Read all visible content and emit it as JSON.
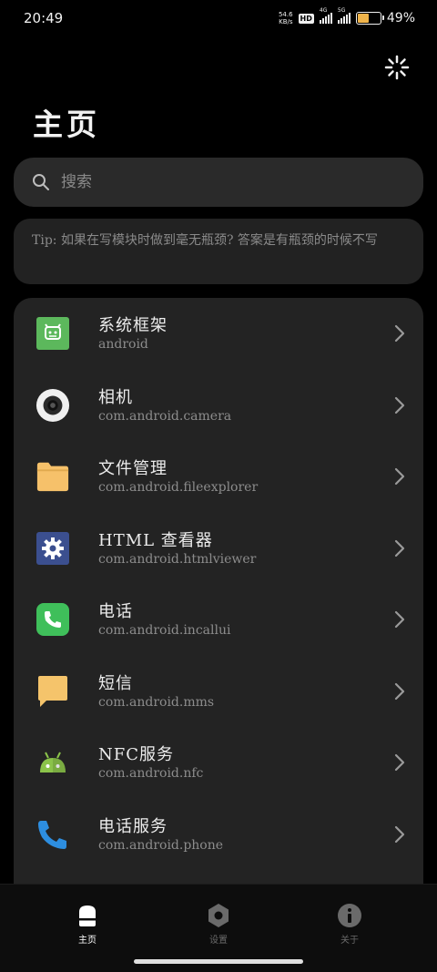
{
  "status_bar": {
    "time": "20:49",
    "net_speed_value": "54.6",
    "net_speed_unit": "KB/s",
    "hd_badge": "HD",
    "signal1_gen": "4G",
    "signal2_gen": "5G",
    "battery_percent": "49%",
    "battery_level": 0.49
  },
  "header": {
    "title": "主页"
  },
  "search": {
    "placeholder": "搜索"
  },
  "tip": {
    "text": "Tip: 如果在写模块时做到毫无瓶颈? 答案是有瓶颈的时候不写"
  },
  "apps": [
    {
      "name": "系统框架",
      "package": "android",
      "icon": "android-framework-icon",
      "icon_color": "#5cb85c"
    },
    {
      "name": "相机",
      "package": "com.android.camera",
      "icon": "camera-icon",
      "icon_color": "#f0f0f0"
    },
    {
      "name": "文件管理",
      "package": "com.android.fileexplorer",
      "icon": "folder-icon",
      "icon_color": "#f6c16a"
    },
    {
      "name": "HTML 查看器",
      "package": "com.android.htmlviewer",
      "icon": "gear-icon",
      "icon_color": "#3b4f8f"
    },
    {
      "name": "电话",
      "package": "com.android.incallui",
      "icon": "phone-icon",
      "icon_color": "#3fbf5a"
    },
    {
      "name": "短信",
      "package": "com.android.mms",
      "icon": "message-icon",
      "icon_color": "#f5c46b"
    },
    {
      "name": "NFC服务",
      "package": "com.android.nfc",
      "icon": "android-robot-icon",
      "icon_color": "#8bc34a"
    },
    {
      "name": "电话服务",
      "package": "com.android.phone",
      "icon": "phone-handset-icon",
      "icon_color": "#2d8ee0"
    }
  ],
  "bottom_nav": {
    "items": [
      {
        "label": "主页",
        "icon": "home-icon",
        "active": true
      },
      {
        "label": "设置",
        "icon": "settings-icon",
        "active": false
      },
      {
        "label": "关于",
        "icon": "info-icon",
        "active": false
      }
    ]
  },
  "colors": {
    "background": "#000000",
    "card": "#232323",
    "text_primary": "#ececec",
    "text_secondary": "#8c8c8c",
    "nav_active": "#ffffff",
    "nav_inactive": "#6a6a6a"
  }
}
